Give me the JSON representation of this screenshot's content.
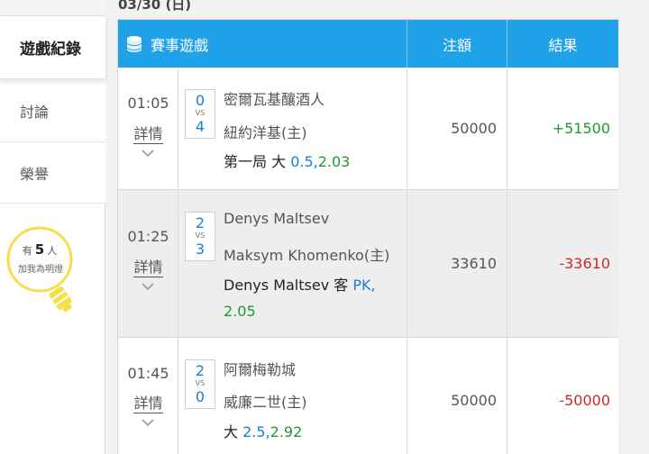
{
  "sidebar": {
    "items": [
      {
        "label": "遊戲紀錄"
      },
      {
        "label": "討論"
      },
      {
        "label": "榮譽"
      }
    ],
    "friends": {
      "prefix": "有",
      "count": "5",
      "suffix": "人",
      "action": "加我為明燈"
    }
  },
  "date": "03/30 (日)",
  "table": {
    "headers": {
      "game": "賽事遊戲",
      "stake": "注額",
      "result": "結果"
    },
    "rows": [
      {
        "time": "01:05",
        "detail": "詳情",
        "score_top": "0",
        "vs": "VS",
        "score_bottom": "4",
        "team1": "密爾瓦基釀酒人",
        "team2": "紐約洋基(主)",
        "bet_text": "第一局 大 ",
        "bet_line": "0.5",
        "bet_sep": ",",
        "bet_odds": "2.03",
        "stake": "50000",
        "result": "+51500"
      },
      {
        "time": "01:25",
        "detail": "詳情",
        "score_top": "2",
        "vs": "VS",
        "score_bottom": "3",
        "team1": "Denys Maltsev",
        "team2": "Maksym Khomenko(主)",
        "bet_text": "Denys Maltsev 客 ",
        "bet_line": "PK",
        "bet_sep": ",",
        "bet_odds": "2.05",
        "stake": "33610",
        "result": "-33610"
      },
      {
        "time": "01:45",
        "detail": "詳情",
        "score_top": "2",
        "vs": "VS",
        "score_bottom": "0",
        "team1": "阿爾梅勒城",
        "team2": "威廉二世(主)",
        "bet_text": "大 ",
        "bet_line": "2.5",
        "bet_sep": ",",
        "bet_odds": "2.92",
        "stake": "50000",
        "result": "-50000"
      }
    ]
  },
  "icons": {
    "header": "database-icon",
    "expand": "chevron-down-icon",
    "friends": "lightbulb-icon"
  },
  "colors": {
    "header_bg": "#1fa2e8",
    "win": "#1e9b2d",
    "lose": "#d12626",
    "link": "#1b7fcf"
  }
}
